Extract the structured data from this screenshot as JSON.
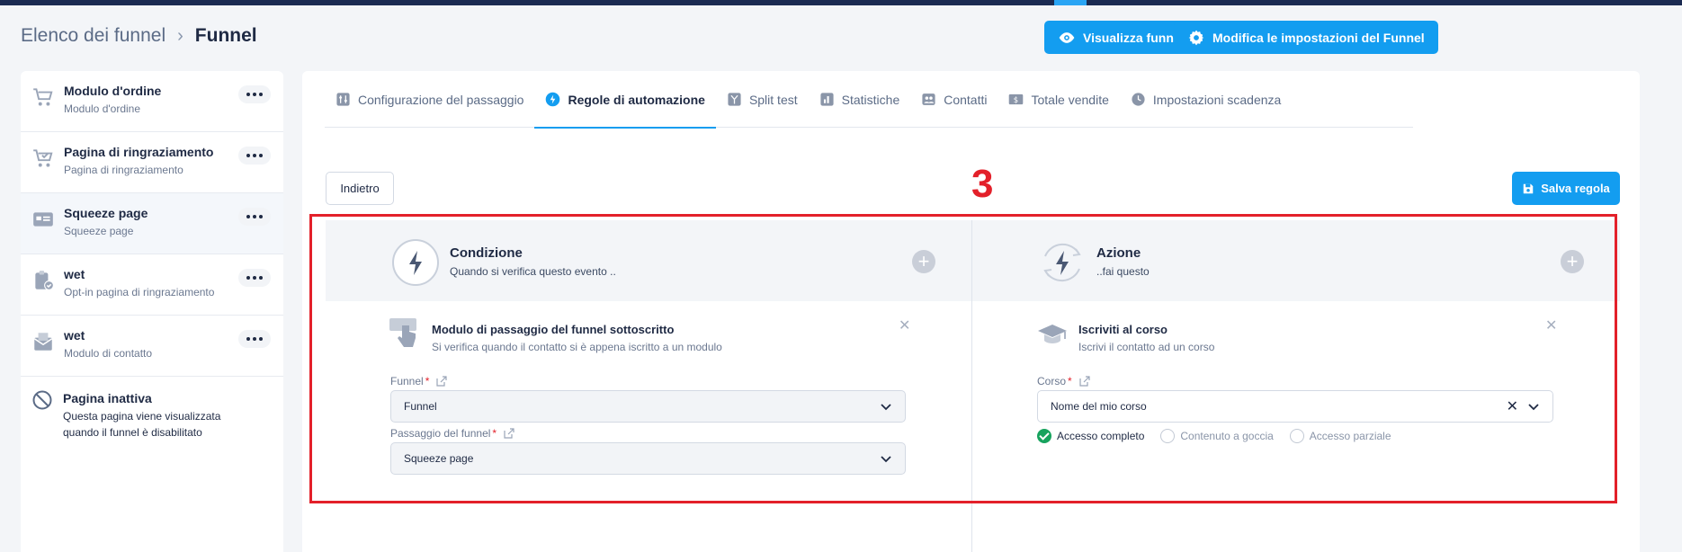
{
  "breadcrumb": {
    "parent": "Elenco dei funnel",
    "separator": "›",
    "current": "Funnel"
  },
  "header_buttons": {
    "view": "Visualizza funnel",
    "settings": "Modifica le impostazioni del Funnel"
  },
  "sidebar": {
    "items": [
      {
        "title": "Modulo d'ordine",
        "subtitle": "Modulo d'ordine",
        "icon": "cart-icon"
      },
      {
        "title": "Pagina di ringraziamento",
        "subtitle": "Pagina di ringraziamento",
        "icon": "cart-check-icon"
      },
      {
        "title": "Squeeze page",
        "subtitle": "Squeeze page",
        "icon": "form-icon"
      },
      {
        "title": "wet",
        "subtitle": "Opt-in pagina di ringraziamento",
        "icon": "clipboard-check-icon"
      },
      {
        "title": "wet",
        "subtitle": "Modulo di contatto",
        "icon": "envelope-icon"
      }
    ],
    "inactive": {
      "title": "Pagina inattiva",
      "subtitle": "Questa pagina viene visualizzata quando il funnel è disabilitato"
    }
  },
  "tabs": [
    {
      "label": "Configurazione del passaggio",
      "icon": "sliders-icon"
    },
    {
      "label": "Regole di automazione",
      "icon": "bolt-icon"
    },
    {
      "label": "Split test",
      "icon": "split-icon"
    },
    {
      "label": "Statistiche",
      "icon": "bar-chart-icon"
    },
    {
      "label": "Contatti",
      "icon": "contacts-icon"
    },
    {
      "label": "Totale vendite",
      "icon": "dollar-icon"
    },
    {
      "label": "Impostazioni scadenza",
      "icon": "clock-icon"
    }
  ],
  "actions": {
    "back": "Indietro",
    "save": "Salva regola",
    "step_number": "3"
  },
  "condition": {
    "title": "Condizione",
    "subtitle": "Quando si verifica questo evento ..",
    "rule_title": "Modulo di passaggio del funnel sottoscritto",
    "rule_sub": "Si verifica quando il contatto si è appena iscritto a un modulo",
    "funnel_label": "Funnel",
    "funnel_value": "Funnel",
    "step_label": "Passaggio del funnel",
    "step_value": "Squeeze page"
  },
  "action": {
    "title": "Azione",
    "subtitle": "..fai questo",
    "rule_title": "Iscriviti al corso",
    "rule_sub": "Iscrivi il contatto ad un corso",
    "course_label": "Corso",
    "course_value": "Nome del mio corso",
    "access_options": [
      "Accesso completo",
      "Contenuto a goccia",
      "Accesso parziale"
    ],
    "selected_access": "Accesso completo"
  },
  "colors": {
    "primary": "#139df0",
    "navy": "#1b2b52",
    "highlight": "#e3202a",
    "success": "#17a35e"
  }
}
